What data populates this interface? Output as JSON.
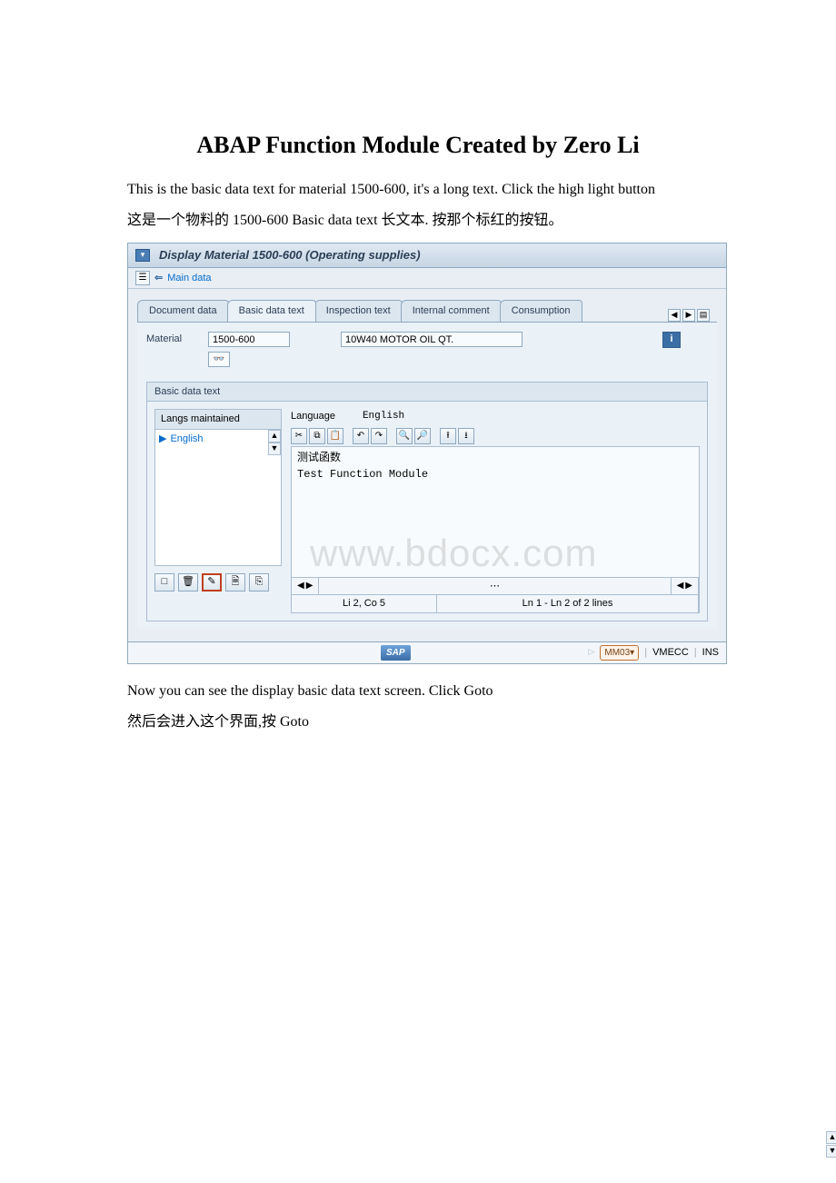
{
  "doc": {
    "title": "ABAP Function Module Created by Zero Li",
    "p1": "This is the basic data text for material 1500-600, it's a long text. Click the high light button",
    "p2": "这是一个物料的 1500-600 Basic data text 长文本. 按那个标红的按钮。",
    "p3": "Now you can see the display basic data text screen. Click Goto",
    "p4": "然后会进入这个界面,按 Goto"
  },
  "sap": {
    "window_title": "Display Material 1500-600 (Operating supplies)",
    "back_arrow": "⇐",
    "main_data": "Main data",
    "tabs": {
      "document": "Document data",
      "basic": "Basic data text",
      "inspection": "Inspection text",
      "internal": "Internal comment",
      "consumption": "Consumption"
    },
    "nav": {
      "left": "◀",
      "right": "▶",
      "list": "▤"
    },
    "material_label": "Material",
    "material_value": "1500-600",
    "material_desc": "10W40 MOTOR OIL QT.",
    "info_icon": "i",
    "section_basic": "Basic data text",
    "langs_header": "Langs maintained",
    "lang_item": "English",
    "language_label": "Language",
    "language_value": "English",
    "editor_line1": "测试函数",
    "editor_line2": "Test Function Module",
    "watermark": "www.bdocx.com",
    "cursor_pos": "Li 2, Co 5",
    "line_range": "Ln 1 - Ln 2 of 2 lines",
    "logo": "SAP",
    "tcode": "MM03",
    "session": "VMECC",
    "mode": "INS"
  },
  "icons": {
    "triangle_right": "▶",
    "scroll_up": "▲",
    "scroll_down": "▼",
    "hscroll_l": "◀",
    "hscroll_r": "▶",
    "cut": "✂",
    "copy": "⧉",
    "paste": "📋",
    "undo": "↶",
    "redo": "↷",
    "find": "🔍",
    "findnext": "🔎",
    "load": "⭱",
    "save": "⭳",
    "new": "□",
    "delete": "🗑",
    "editor": "✎",
    "doc": "🗎",
    "page": "⎘",
    "glasses": "👓",
    "play_tri": "▷",
    "dropdown": "▾"
  }
}
